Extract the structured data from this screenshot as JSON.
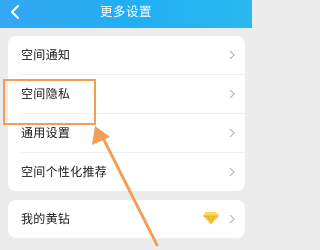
{
  "header": {
    "title": "更多设置",
    "back_icon": "back-arrow-icon"
  },
  "settings_list": {
    "items": [
      {
        "label": "空间通知",
        "icon": "chevron-right-icon"
      },
      {
        "label": "空间隐私",
        "icon": "chevron-right-icon"
      },
      {
        "label": "通用设置",
        "icon": "chevron-right-icon"
      },
      {
        "label": "空间个性化推荐",
        "icon": "chevron-right-icon"
      }
    ]
  },
  "diamond_item": {
    "label": "我的黄钻",
    "badge_icon": "yellow-diamond-icon",
    "icon": "chevron-right-icon"
  },
  "annotation": {
    "highlighted_item": "空间隐私",
    "color": "#f29e59"
  },
  "colors": {
    "header": "#2aaef3",
    "background": "#ececec",
    "card": "#ffffff",
    "highlight": "#f29e59",
    "diamond": "#f7c531"
  }
}
